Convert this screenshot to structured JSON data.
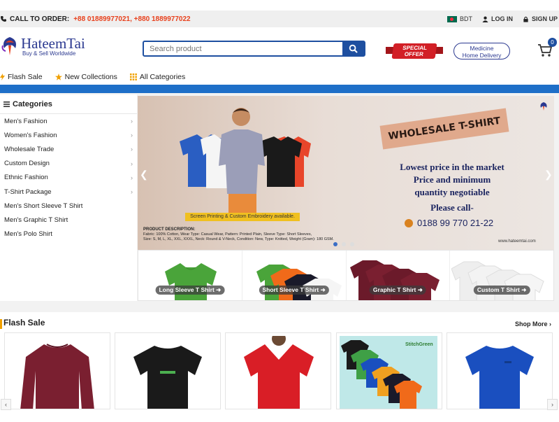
{
  "topbar": {
    "call_label": "CALL TO ORDER:",
    "phones": "+88 01889977021,  +880 1889977022",
    "currency": "BDT",
    "login": "LOG IN",
    "signup": "SIGN UP"
  },
  "header": {
    "brand": "HateemTai",
    "tagline": "Buy & Sell Worldwide",
    "search_placeholder": "Search product",
    "special_offer": "SPECIAL OFFER",
    "medicine_line1": "Medicine",
    "medicine_line2": "Home Delivery",
    "cart_count": "0"
  },
  "nav": {
    "items": [
      "Flash Sale",
      "New Collections",
      "All Categories"
    ]
  },
  "categories": {
    "title": "Categories",
    "items": [
      {
        "label": "Men's Fashion",
        "has_children": true
      },
      {
        "label": "Women's Fashion",
        "has_children": true
      },
      {
        "label": "Wholesale Trade",
        "has_children": true
      },
      {
        "label": "Custom Design",
        "has_children": true
      },
      {
        "label": "Ethnic Fashion",
        "has_children": true
      },
      {
        "label": "T-Shirt Package",
        "has_children": true
      },
      {
        "label": "Men's Short Sleeve T Shirt",
        "has_children": false
      },
      {
        "label": "Men's Graphic T Shirt",
        "has_children": false
      },
      {
        "label": "Men's Polo Shirt",
        "has_children": false
      }
    ]
  },
  "banner": {
    "headline": "WHOLESALE T-SHIRT",
    "line1": "Lowest price in the market",
    "line2": "Price and minimum",
    "line3": "quantity negotiable",
    "line4": "Please call-",
    "phone": "0188 99 770 21-22",
    "note": "Screen Printing & Custom Embroidery available.",
    "desc_title": "PRODUCT DESCRIPTION:",
    "desc_line1": "Fabric: 100% Cotton, Wear Type: Casual Wear, Pattern: Printed Plain, Sleeve Type: Short Sleeves,",
    "desc_line2": "Size: S, M, L, XL, XXL, XXXL, Neck: Round & V-Neck, Condition: New, Type: Knitted, Weight (Gram): 180 GSM.",
    "site": "www.hateemtai.com"
  },
  "strip": {
    "items": [
      "Long Sleeve T Shirt",
      "Short Sleeve T Shirt",
      "Graphic T Shirt",
      "Custom T Shirt"
    ]
  },
  "flash_sale": {
    "title": "Flash Sale",
    "shop_more": "Shop More"
  },
  "colors": {
    "brand_blue": "#1e4fa0",
    "accent_red": "#e8401c",
    "nav_blue": "#1e6fc8"
  }
}
